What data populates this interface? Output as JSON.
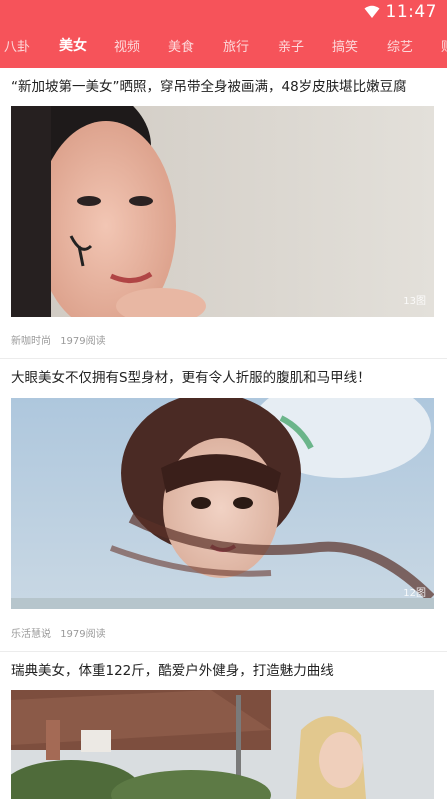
{
  "status": {
    "time": "11:47",
    "wifi_icon": "wifi-icon"
  },
  "colors": {
    "header": "#f6535a",
    "active_tab": "#ffffff"
  },
  "tabs": [
    {
      "label": "八卦"
    },
    {
      "label": "美女"
    },
    {
      "label": "视频"
    },
    {
      "label": "美食"
    },
    {
      "label": "旅行"
    },
    {
      "label": "亲子"
    },
    {
      "label": "搞笑"
    },
    {
      "label": "综艺"
    },
    {
      "label": "财"
    }
  ],
  "active_tab": "美女",
  "articles": [
    {
      "title": "“新加坡第一美女”晒照，穿吊带全身被画满，48岁皮肤堪比嫩豆腐",
      "image_count": "13图",
      "source": "新咖时尚",
      "reads": "1979阅读"
    },
    {
      "title": "大眼美女不仅拥有S型身材，更有令人折服的腹肌和马甲线！",
      "image_count": "12图",
      "source": "乐活慧说",
      "reads": "1979阅读"
    },
    {
      "title": "瑞典美女，体重122斤，酷爱户外健身，打造魅力曲线"
    }
  ]
}
